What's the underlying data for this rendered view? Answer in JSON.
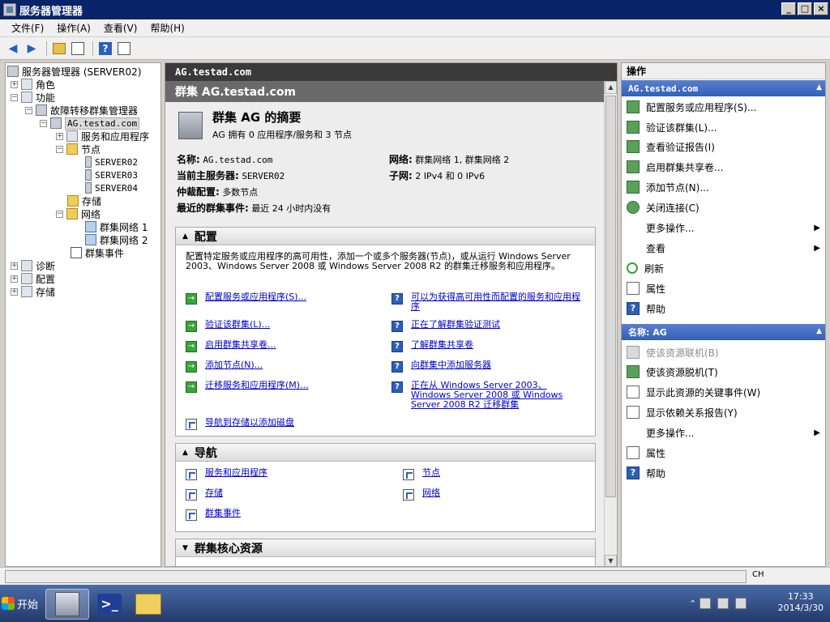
{
  "window": {
    "title": "服务器管理器"
  },
  "menu": [
    "文件(F)",
    "操作(A)",
    "查看(V)",
    "帮助(H)"
  ],
  "tree": {
    "root": "服务器管理器 (SERVER02)",
    "roles": "角色",
    "features": "功能",
    "fcm": "故障转移群集管理器",
    "cluster": "AG.testad.com",
    "services": "服务和应用程序",
    "nodes": "节点",
    "node1": "SERVER02",
    "node2": "SERVER03",
    "node3": "SERVER04",
    "storage": "存储",
    "networks": "网络",
    "net1": "群集网络 1",
    "net2": "群集网络 2",
    "events": "群集事件",
    "diagnostics": "诊断",
    "config": "配置",
    "storage2": "存储"
  },
  "center": {
    "header": "AG.testad.com",
    "subheader": "群集 AG.testad.com",
    "summary_title": "群集 AG 的摘要",
    "summary_sub": "AG 拥有 0 应用程序/服务和 3 节点",
    "name_label": "名称:",
    "name_value": "AG.testad.com",
    "host_label": "当前主服务器:",
    "host_value": "SERVER02",
    "quorum_label": "仲裁配置:",
    "quorum_value": "多数节点",
    "events_label": "最近的群集事件:",
    "events_value": "最近 24 小时内没有",
    "network_label": "网络:",
    "network_value": "群集网络 1, 群集网络 2",
    "subnet_label": "子网:",
    "subnet_value": "2 IPv4 和 0 IPv6",
    "config_section": {
      "title": "配置",
      "desc": "配置特定服务或应用程序的高可用性，添加一个或多个服务器(节点)，或从运行 Windows Server 2003、Windows Server 2008 或 Windows Server 2008 R2 的群集迁移服务和应用程序。",
      "left_links": [
        "配置服务或应用程序(S)...",
        "验证该群集(L)...",
        "启用群集共享卷...",
        "添加节点(N)...",
        "迁移服务和应用程序(M)..."
      ],
      "right_links": [
        "可以为获得高可用性而配置的服务和应用程序",
        "正在了解群集验证测试",
        "了解群集共享卷",
        "向群集中添加服务器",
        "正在从 Windows Server 2003、Windows Server 2008 或 Windows Server 2008 R2 迁移群集"
      ],
      "storage_link": "导航到存储以添加磁盘"
    },
    "nav_section": {
      "title": "导航",
      "services": "服务和应用程序",
      "storage": "存储",
      "events": "群集事件",
      "nodes": "节点",
      "networks": "网络"
    },
    "core_section": {
      "title": "群集核心资源"
    }
  },
  "actions": {
    "title": "操作",
    "group1": "AG.testad.com",
    "items1": [
      "配置服务或应用程序(S)...",
      "验证该群集(L)...",
      "查看验证报告(I)",
      "启用群集共享卷...",
      "添加节点(N)...",
      "关闭连接(C)",
      "更多操作...",
      "查看",
      "刷新",
      "属性",
      "帮助"
    ],
    "group2": "名称: AG",
    "items2": [
      "使该资源联机(B)",
      "使该资源脱机(T)",
      "显示此资源的关键事件(W)",
      "显示依赖关系报告(Y)",
      "更多操作...",
      "属性",
      "帮助"
    ]
  },
  "taskbar": {
    "start": "开始",
    "lang": "CH",
    "time": "17:33",
    "date": "2014/3/30"
  }
}
